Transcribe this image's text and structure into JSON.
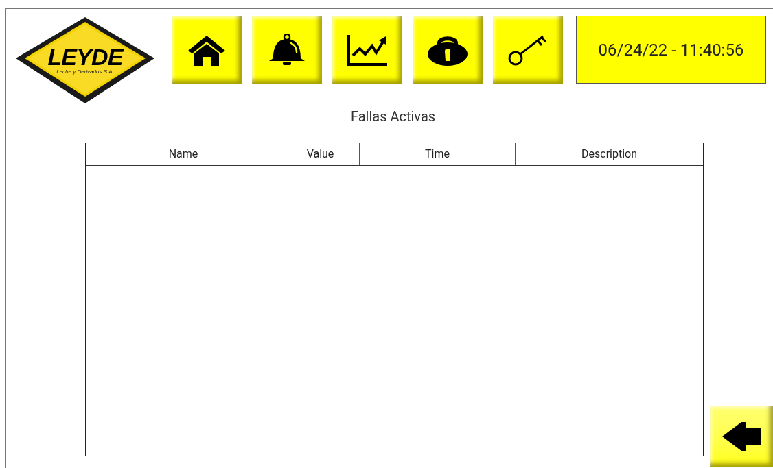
{
  "logo": {
    "brand": "LEYDE",
    "tagline": "Leche y Derivados S.A."
  },
  "nav_buttons": [
    {
      "kind": "home"
    },
    {
      "kind": "alarm"
    },
    {
      "kind": "trend"
    },
    {
      "kind": "lock"
    },
    {
      "kind": "key"
    }
  ],
  "clock": "06/24/22 - 11:40:56",
  "title": "Fallas Activas",
  "table": {
    "columns": [
      "Name",
      "Value",
      "Time",
      "Description"
    ]
  },
  "back_button": {
    "kind": "back"
  }
}
